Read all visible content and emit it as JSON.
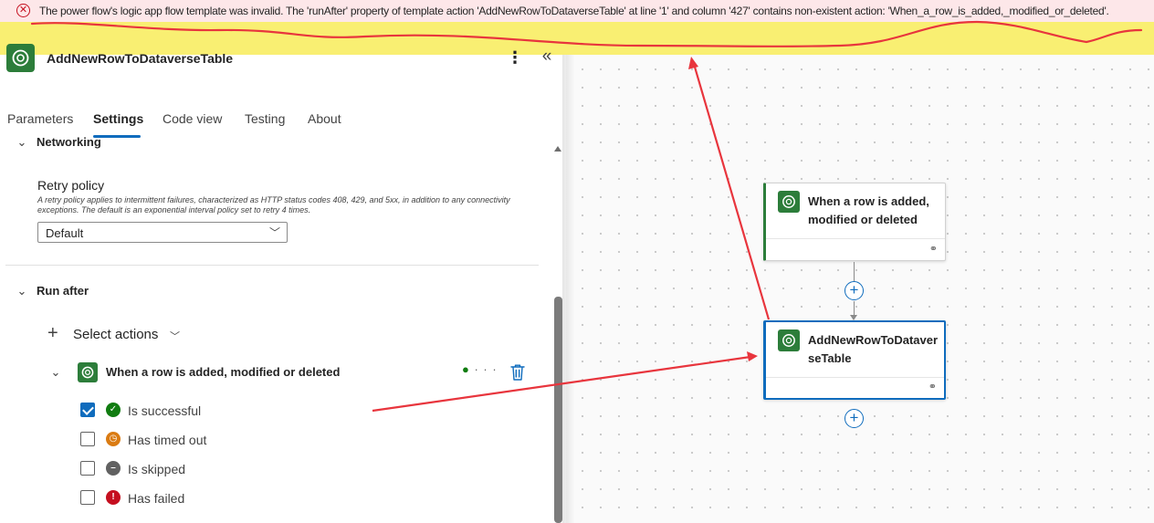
{
  "error_banner": {
    "icon": "error-circle-icon",
    "message": "The power flow's logic app flow template was invalid. The 'runAfter' property of template action 'AddNewRowToDataverseTable' at line '1' and column '427' contains non-existent action: 'When_a_row_is_added,_modified_or_deleted'."
  },
  "panel": {
    "title": "AddNewRowToDataverseTable",
    "more_icon": "more-vertical-icon",
    "collapse_icon": "double-chevron-left-icon",
    "tabs": [
      {
        "label": "Parameters",
        "active": false
      },
      {
        "label": "Settings",
        "active": true
      },
      {
        "label": "Code view",
        "active": false
      },
      {
        "label": "Testing",
        "active": false
      },
      {
        "label": "About",
        "active": false
      }
    ],
    "networking": {
      "title": "Networking",
      "retry_policy_label": "Retry policy",
      "retry_policy_description": "A retry policy applies to intermittent failures, characterized as HTTP status codes 408, 429, and 5xx, in addition to any connectivity exceptions. The default is an exponential interval policy set to retry 4 times.",
      "retry_policy_value": "Default"
    },
    "run_after": {
      "title": "Run after",
      "select_actions_label": "Select actions",
      "action_name": "When a row is added, modified or deleted",
      "conditions": [
        {
          "label": "Is successful",
          "checked": true,
          "icon": "success-check-icon",
          "color": "#107c10"
        },
        {
          "label": "Has timed out",
          "checked": false,
          "icon": "clock-icon",
          "color": "#da7b12"
        },
        {
          "label": "Is skipped",
          "checked": false,
          "icon": "skipped-minus-icon",
          "color": "#616161"
        },
        {
          "label": "Has failed",
          "checked": false,
          "icon": "failed-exclamation-icon",
          "color": "#c50f1f"
        }
      ]
    }
  },
  "canvas": {
    "nodes": [
      {
        "title": "When a row is added, modified or deleted",
        "selected": false
      },
      {
        "title": "AddNewRowToDataverseTable",
        "selected": true
      }
    ]
  },
  "colors": {
    "banner_highlight": "#f9ef72",
    "accent": "#0f6cbd",
    "dataverse_green": "#2c7d3a",
    "annotation_red": "#e8353d"
  }
}
